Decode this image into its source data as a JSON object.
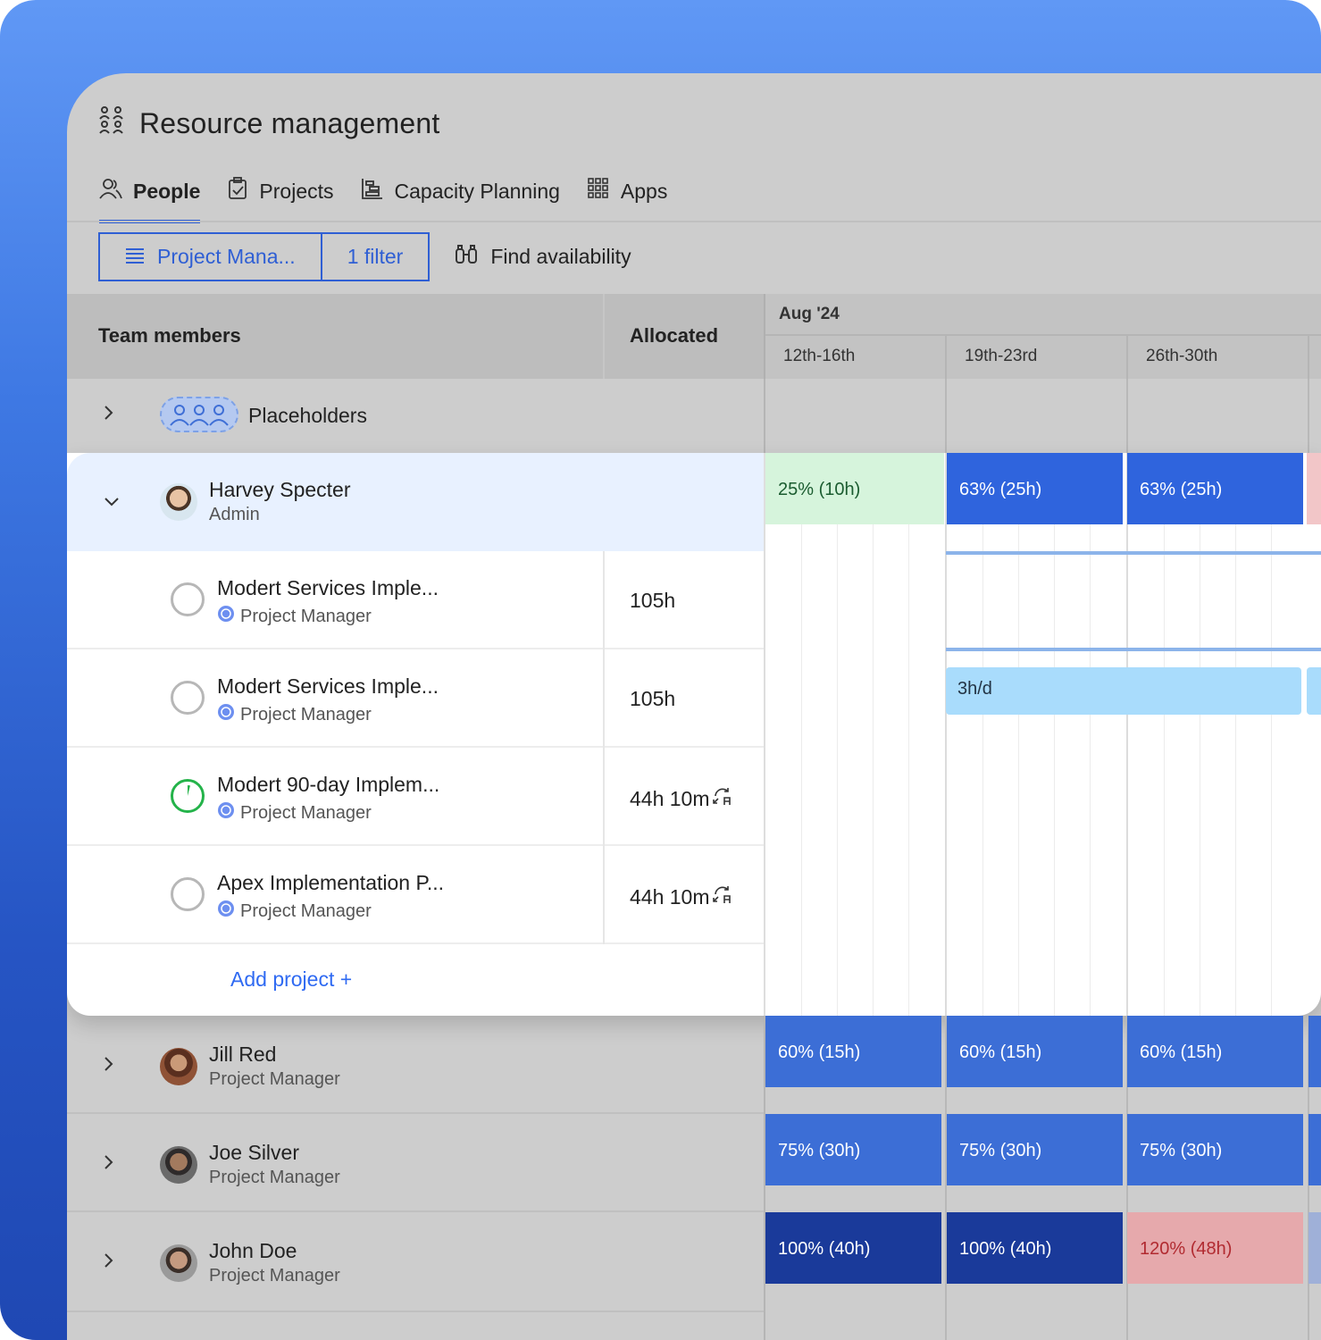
{
  "header": {
    "title": "Resource management",
    "icon": "people-group-icon"
  },
  "tabs": [
    {
      "label": "People",
      "icon": "user-icon",
      "active": true
    },
    {
      "label": "Projects",
      "icon": "clipboard-icon",
      "active": false
    },
    {
      "label": "Capacity Planning",
      "icon": "timeline-icon",
      "active": false
    },
    {
      "label": "Apps",
      "icon": "grid-icon",
      "active": false
    }
  ],
  "toolbar": {
    "view_label": "Project Mana...",
    "filter_label": "1 filter",
    "find_label": "Find availability"
  },
  "table": {
    "col_members": "Team members",
    "col_allocated": "Allocated",
    "month": "Aug '24",
    "weeks": [
      "12th-16th",
      "19th-23rd",
      "26th-30th"
    ]
  },
  "placeholders": {
    "label": "Placeholders"
  },
  "harvey": {
    "name": "Harvey Specter",
    "role": "Admin",
    "bars": [
      "25% (10h)",
      "63% (25h)",
      "63% (25h)"
    ]
  },
  "projects": [
    {
      "name": "Modert Services Imple...",
      "role": "Project Manager",
      "hours": "105h",
      "status": "empty"
    },
    {
      "name": "Modert Services Imple...",
      "role": "Project Manager",
      "hours": "105h",
      "status": "empty"
    },
    {
      "name": "Modert 90-day Implem...",
      "role": "Project Manager",
      "hours": "44h 10m",
      "status": "in-progress"
    },
    {
      "name": "Apex Implementation P...",
      "role": "Project Manager",
      "hours": "44h 10m",
      "status": "empty"
    }
  ],
  "assignment": {
    "label": "3h/d"
  },
  "add_project": "Add project  +",
  "people": [
    {
      "name": "Jill Red",
      "role": "Project Manager",
      "bars": [
        "60% (15h)",
        "60% (15h)",
        "60% (15h)"
      ]
    },
    {
      "name": "Joe Silver",
      "role": "Project Manager",
      "bars": [
        "75% (30h)",
        "75% (30h)",
        "75% (30h)"
      ]
    },
    {
      "name": "John Doe",
      "role": "Project Manager",
      "bars": [
        "100% (40h)",
        "100% (40h)",
        "120% (48h)"
      ]
    }
  ],
  "colors": {
    "accent": "#2f5fd4",
    "bar_blue": "#3c6ed6",
    "bar_dark": "#1a3a9a",
    "bar_over": "#e6a9ac",
    "bar_under": "#d6f4dc"
  }
}
